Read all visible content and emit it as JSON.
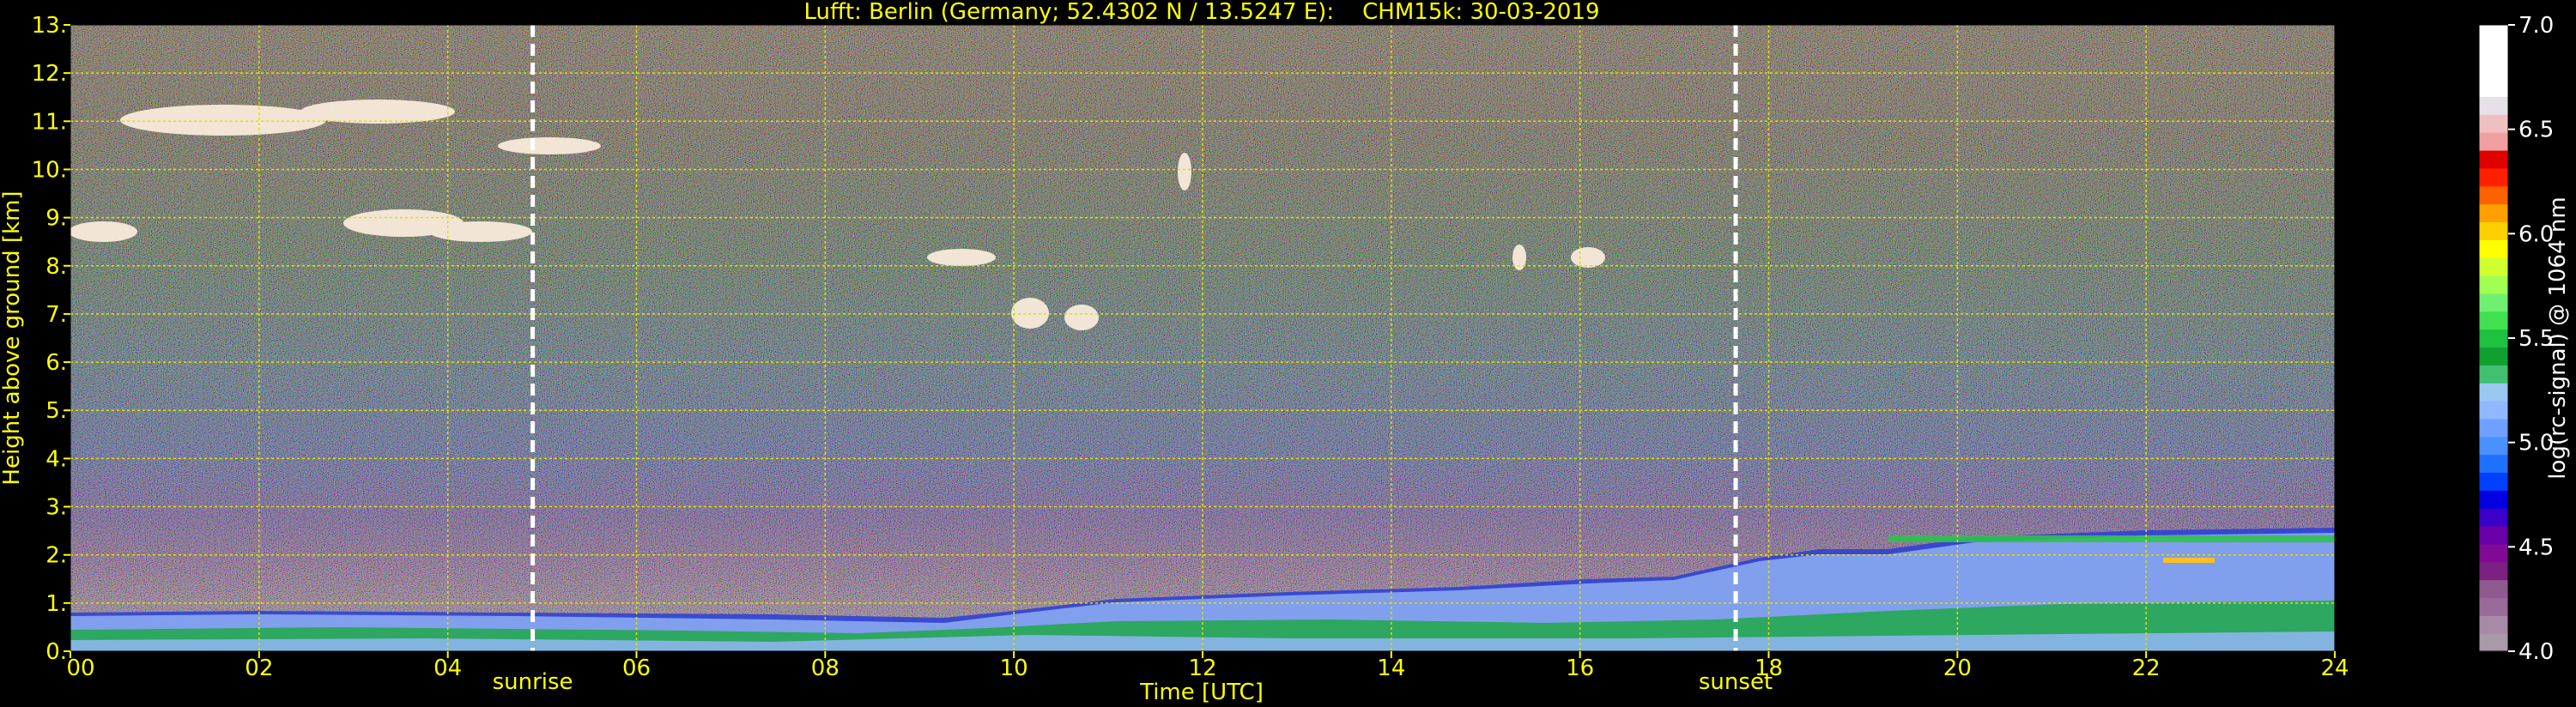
{
  "chart_data": {
    "type": "heatmap",
    "title": "Lufft: Berlin (Germany; 52.4302 N / 13.5247 E):    CHM15k: 30-03-2019",
    "xlabel": "Time [UTC]",
    "ylabel": "Height above ground [km]",
    "xlim": [
      0,
      24
    ],
    "ylim": [
      0,
      13
    ],
    "x_ticks": [
      0,
      2,
      4,
      6,
      8,
      10,
      12,
      14,
      16,
      18,
      20,
      22,
      24
    ],
    "x_tick_labels": [
      "00",
      "02",
      "04",
      "06",
      "08",
      "10",
      "12",
      "14",
      "16",
      "18",
      "20",
      "22",
      "24"
    ],
    "y_ticks": [
      0,
      1,
      2,
      3,
      4,
      5,
      6,
      7,
      8,
      9,
      10,
      11,
      12,
      13
    ],
    "y_tick_labels": [
      "0.",
      "1.",
      "2.",
      "3.",
      "4.",
      "5.",
      "6.",
      "7.",
      "8.",
      "9.",
      "10.",
      "11.",
      "12.",
      "13."
    ],
    "grid": true,
    "markers": [
      {
        "label": "sunrise",
        "x": 4.9
      },
      {
        "label": "sunset",
        "x": 17.65
      }
    ],
    "colorbar": {
      "label": "log(rc-signal) @ 1064 nm",
      "min": 4.0,
      "max": 7.0,
      "ticks": [
        4.0,
        4.5,
        5.0,
        5.5,
        6.0,
        6.5,
        7.0
      ],
      "tick_labels": [
        "4.0",
        "4.5",
        "5.0",
        "5.5",
        "6.0",
        "6.5",
        "7.0"
      ],
      "colors": [
        "#a89aa8",
        "#a889a8",
        "#9a6a9a",
        "#8f5a8f",
        "#7a2080",
        "#800a95",
        "#6a00a8",
        "#3a00c8",
        "#0000e0",
        "#0040ff",
        "#2070ff",
        "#4a90ff",
        "#70a0ff",
        "#90b8ff",
        "#9ac8f0",
        "#40c070",
        "#10a030",
        "#20c040",
        "#40e050",
        "#70f070",
        "#a0ff50",
        "#d0ff30",
        "#ffff00",
        "#ffd000",
        "#ffa000",
        "#ff6000",
        "#ff2000",
        "#e00000",
        "#f0a0a0",
        "#f0c0c0",
        "#e8e0e8",
        "#ffffff",
        "#ffffff",
        "#ffffff",
        "#ffffff"
      ]
    }
  }
}
